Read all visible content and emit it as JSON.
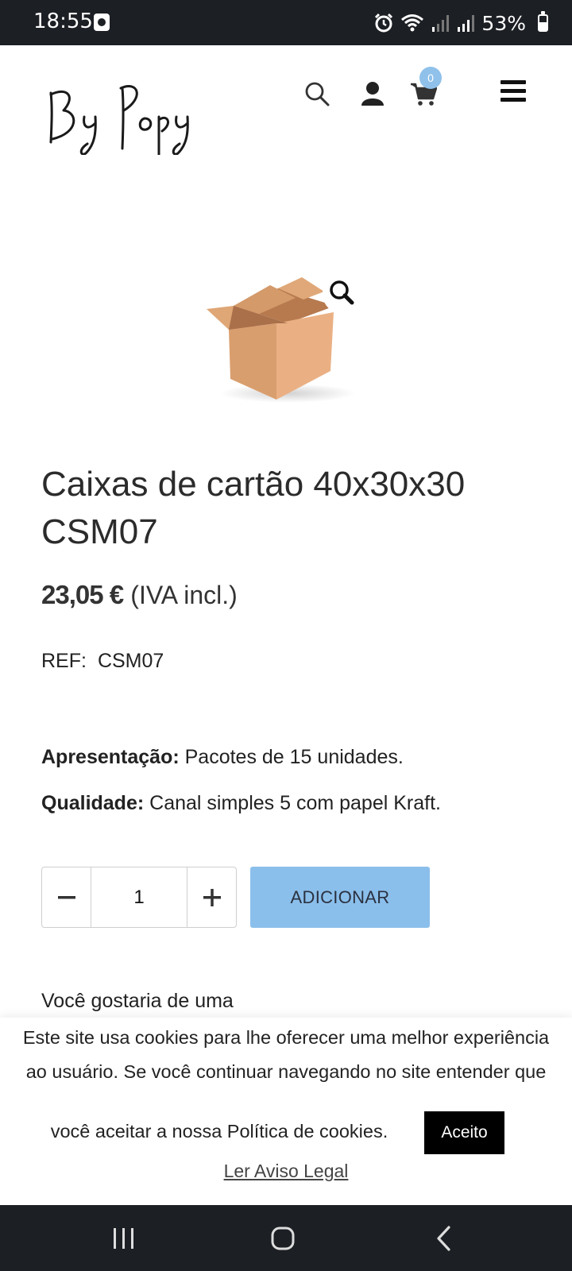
{
  "status_bar": {
    "time": "18:55",
    "battery": "53%",
    "icons": [
      "notification-app-icon",
      "alarm-icon",
      "wifi-icon",
      "signal-icon",
      "signal-icon",
      "battery-icon"
    ]
  },
  "header": {
    "logo_text": "By Popy",
    "cart_count": "0",
    "icons": [
      "search-icon",
      "account-icon",
      "cart-icon",
      "menu-icon"
    ]
  },
  "product": {
    "image_alt": "cardboard box",
    "title": "Caixas de cartão 40x30x30 CSM07",
    "price": "23,05 €",
    "price_note": "(IVA incl.)",
    "ref_label": "REF:",
    "ref_value": "CSM07",
    "specs": [
      {
        "label": "Apresentação:",
        "value": "Pacotes de 15 unidades."
      },
      {
        "label": "Qualidade:",
        "value": "Canal simples 5 com papel Kraft."
      }
    ],
    "quantity": "1",
    "add_label": "ADICIONAR",
    "partial_text": "Você gostaria de uma"
  },
  "cookie_banner": {
    "line1": "Este site usa cookies para lhe oferecer uma melhor experiência",
    "line2": "ao usuário. Se você continuar navegando no site entender que",
    "line3": "você aceitar a nossa Política de cookies.",
    "accept_label": "Aceito",
    "legal_link": "Ler Aviso Legal"
  },
  "colors": {
    "accent": "#8bbfeb",
    "badge": "#8fc1ea",
    "system_bar": "#1c1f24"
  }
}
